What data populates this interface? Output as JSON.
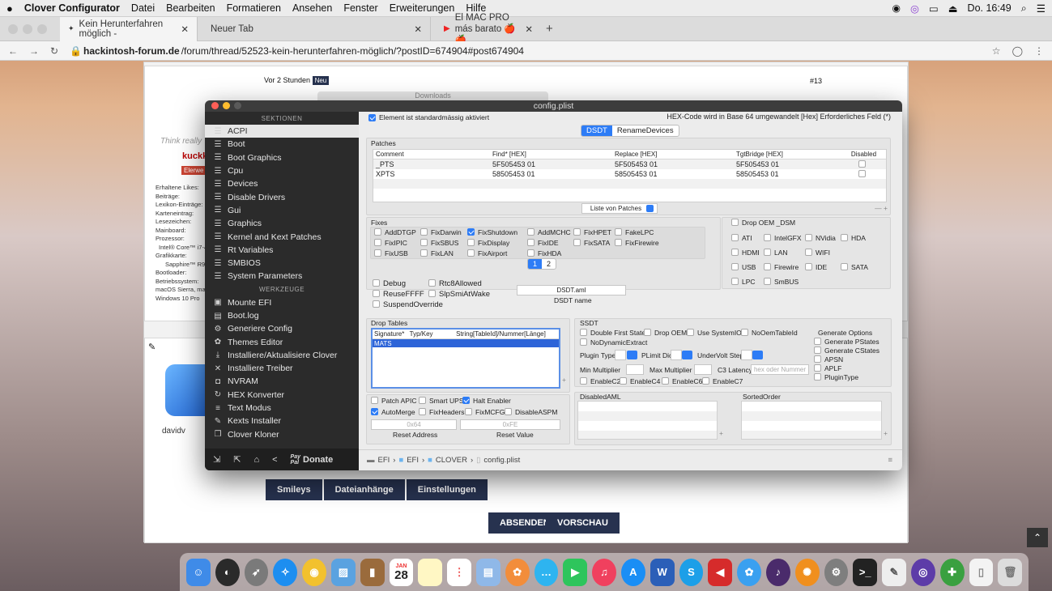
{
  "menubar": {
    "app": "Clover Configurator",
    "items": [
      "Datei",
      "Bearbeiten",
      "Formatieren",
      "Ansehen",
      "Fenster",
      "Erweiterungen",
      "Hilfe"
    ],
    "clock": "Do. 16:49"
  },
  "browser": {
    "tabs": [
      {
        "label": "Kein Herunterfahren möglich -"
      },
      {
        "label": "Neuer Tab"
      },
      {
        "label": "El MAC PRO más barato 🍎 🍎"
      }
    ],
    "url_domain": "hackintosh-forum.de",
    "url_path": "/forum/thread/52523-kein-herunterfahren-möglich/?postID=674904#post674904"
  },
  "forum": {
    "post_time": "Vor 2 Stunden",
    "new_badge": "Neu",
    "post_number": "#13",
    "think_text": "Think really",
    "username1": "kuckk",
    "role_badge": "Elerwe",
    "profile_labels": [
      "Erhaltene Likes:",
      "Beiträge:",
      "Lexikon-Einträge:",
      "Karteneintrag:",
      "Lesezeichen:",
      "Mainboard:",
      "Prozessor:",
      "Intel® Core™ i7-4",
      "Grafikkarte:",
      "Sapphire™ R9",
      "Bootloader:",
      "Betriebssystem:",
      "macOS Sierra, mac",
      "Windows 10 Pro"
    ],
    "username2": "davidv",
    "editor_buttons": [
      "Smileys",
      "Dateianhänge",
      "Einstellungen"
    ],
    "submit": "ABSENDEN",
    "preview": "VORSCHAU",
    "downloads_title": "Downloads"
  },
  "clover": {
    "window_title": "config.plist",
    "sections_header": "SEKTIONEN",
    "sections": [
      "ACPI",
      "Boot",
      "Boot Graphics",
      "Cpu",
      "Devices",
      "Disable Drivers",
      "Gui",
      "Graphics",
      "Kernel and Kext Patches",
      "Rt Variables",
      "SMBIOS",
      "System Parameters"
    ],
    "tools_header": "WERKZEUGE",
    "tools": [
      "Mounte EFI",
      "Boot.log",
      "Generiere Config",
      "Themes Editor",
      "Installiere/Aktualisiere Clover",
      "Installiere Treiber",
      "NVRAM",
      "HEX Konverter",
      "Text Modus",
      "Kexts Installer",
      "Clover Kloner"
    ],
    "donate": "Donate",
    "top_note": "Element ist standardmässig aktiviert",
    "top_right": "HEX-Code wird in Base 64 umgewandelt [Hex]   Erforderliches Feld (*)",
    "seg_tabs": [
      "DSDT",
      "RenameDevices"
    ],
    "patches_title": "Patches",
    "patch_headers": [
      "Comment",
      "Find* [HEX]",
      "Replace [HEX]",
      "TgtBridge [HEX]",
      "Disabled"
    ],
    "patches": [
      [
        "_PTS",
        "5F505453 01",
        "5F505453 01",
        "5F505453 01"
      ],
      [
        "XPTS",
        "58505453 01",
        "58505453 01",
        "58505453 01"
      ]
    ],
    "patch_list_select": "Liste von Patches",
    "fixes_title": "Fixes",
    "fixes": [
      {
        "label": "AddDTGP",
        "on": false
      },
      {
        "label": "FixDarwin",
        "on": false
      },
      {
        "label": "FixShutdown",
        "on": true
      },
      {
        "label": "AddMCHC",
        "on": false
      },
      {
        "label": "FixHPET",
        "on": false
      },
      {
        "label": "FakeLPC",
        "on": false
      },
      {
        "label": "FixIPIC",
        "on": false
      },
      {
        "label": "FixSBUS",
        "on": false
      },
      {
        "label": "FixDisplay",
        "on": false
      },
      {
        "label": "FixIDE",
        "on": false
      },
      {
        "label": "FixSATA",
        "on": false
      },
      {
        "label": "FixFirewire",
        "on": false
      },
      {
        "label": "FixUSB",
        "on": false
      },
      {
        "label": "FixLAN",
        "on": false
      },
      {
        "label": "FixAirport",
        "on": false
      },
      {
        "label": "FixHDA",
        "on": false
      }
    ],
    "fix_pages": [
      "1",
      "2"
    ],
    "drop_oem": "Drop OEM _DSM",
    "dsm_items": [
      "ATI",
      "IntelGFX",
      "NVidia",
      "HDA",
      "HDMI",
      "LAN",
      "WIFI",
      "USB",
      "Firewire",
      "IDE",
      "SATA",
      "LPC",
      "SmBUS"
    ],
    "misc_checks": [
      "Debug",
      "Rtc8Allowed",
      "ReuseFFFF",
      "SlpSmiAtWake",
      "SuspendOverride"
    ],
    "dsdt_name_value": "DSDT.aml",
    "dsdt_name_label": "DSDT name",
    "drop_tables_title": "Drop Tables",
    "drop_headers": [
      "Signature*",
      "Typ/Key",
      "String[TableId]/Nummer[Länge]"
    ],
    "drop_row": "MATS",
    "ssdt_title": "SSDT",
    "ssdt_checks": [
      "Double First State",
      "Drop OEM",
      "Use SystemIO",
      "NoOemTableId",
      "NoDynamicExtract"
    ],
    "ssdt_labels": {
      "plugin_type": "Plugin Type",
      "plimit": "PLimit Dict",
      "undervolt": "UnderVolt Step",
      "min_mult": "Min Multiplier",
      "max_mult": "Max Multiplier",
      "c3": "C3 Latency",
      "c3_placeholder": "hex oder Nummer"
    },
    "enable_checks": [
      "EnableC2",
      "EnableC4",
      "EnableC6",
      "EnableC7"
    ],
    "generate_title": "Generate Options",
    "generate_options": [
      "Generate PStates",
      "Generate CStates",
      "APSN",
      "APLF",
      "PluginType"
    ],
    "bottom_checks": [
      {
        "label": "Patch APIC",
        "on": false
      },
      {
        "label": "Smart UPS",
        "on": false
      },
      {
        "label": "Halt Enabler",
        "on": true
      },
      {
        "label": "AutoMerge",
        "on": true
      },
      {
        "label": "FixHeaders",
        "on": false
      },
      {
        "label": "FixMCFG",
        "on": false
      },
      {
        "label": "DisableASPM",
        "on": false
      }
    ],
    "reset_address_value": "0x64",
    "reset_address_label": "Reset Address",
    "reset_value_value": "0xFE",
    "reset_value_label": "Reset Value",
    "disabled_aml_title": "DisabledAML",
    "sorted_order_title": "SortedOrder",
    "path": [
      "EFI",
      "EFI",
      "CLOVER",
      "config.plist"
    ]
  },
  "dock": {
    "calendar_month": "JAN",
    "calendar_day": "28"
  },
  "colors": {
    "accent": "#2d7cf6",
    "sidebar": "#2b2b2b",
    "forum_button": "#27324f"
  }
}
